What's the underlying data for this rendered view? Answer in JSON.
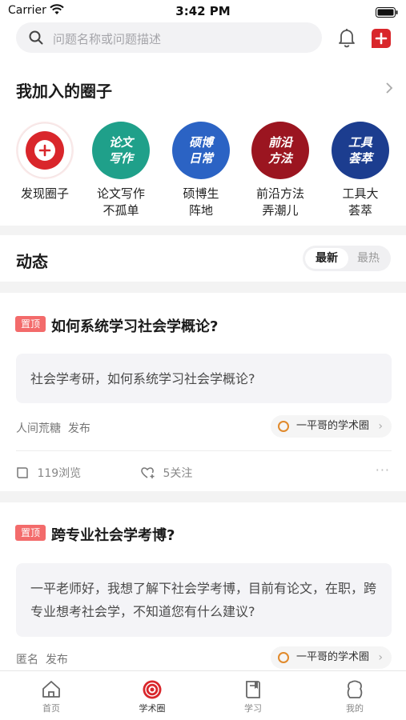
{
  "status_bar": {
    "carrier": "Carrier",
    "time": "3:42 PM"
  },
  "search": {
    "placeholder": "问题名称或问题描述"
  },
  "my_circles": {
    "title": "我加入的圈子",
    "items": [
      {
        "label_line1": "发现圈子",
        "label_line2": "",
        "icon": "add-circle-icon",
        "badge_line1": "",
        "badge_line2": "",
        "color": "#d9262b"
      },
      {
        "label_line1": "论文写作",
        "label_line2": "不孤单",
        "icon": "",
        "badge_line1": "论文",
        "badge_line2": "写作",
        "color": "#1fa08a"
      },
      {
        "label_line1": "硕博生",
        "label_line2": "阵地",
        "icon": "",
        "badge_line1": "硕博",
        "badge_line2": "日常",
        "color": "#2b63c4"
      },
      {
        "label_line1": "前沿方法",
        "label_line2": "弄潮儿",
        "icon": "",
        "badge_line1": "前沿",
        "badge_line2": "方法",
        "color": "#9b1520"
      },
      {
        "label_line1": "工具大",
        "label_line2": "荟萃",
        "icon": "",
        "badge_line1": "工具",
        "badge_line2": "荟萃",
        "color": "#1c3d8f"
      }
    ]
  },
  "feed": {
    "title": "动态",
    "tabs": {
      "active": "最新",
      "inactive": "最热"
    }
  },
  "posts": [
    {
      "badge": "置顶",
      "title": "如何系统学习社会学概论?",
      "content": "社会学考研，如何系统学习社会学概论?",
      "author": "人间荒糖",
      "action": "发布",
      "circle": "一平哥的学术圈",
      "views": "119浏览",
      "follows": "5关注"
    },
    {
      "badge": "置顶",
      "title": "跨专业社会学考博?",
      "content": "一平老师好，我想了解下社会学考博，目前有论文，在职，跨专业想考社会学，不知道您有什么建议?",
      "author": "匿名",
      "action": "发布",
      "circle": "一平哥的学术圈"
    }
  ],
  "tabbar": {
    "items": [
      {
        "label": "首页",
        "icon": "home-icon"
      },
      {
        "label": "学术圈",
        "icon": "academic-circle-icon",
        "active": true
      },
      {
        "label": "学习",
        "icon": "book-icon"
      },
      {
        "label": "我的",
        "icon": "profile-icon"
      }
    ]
  },
  "colors": {
    "accent": "#d9262b",
    "badge": "#f36b6b",
    "circle_ring": "#e0892b"
  }
}
